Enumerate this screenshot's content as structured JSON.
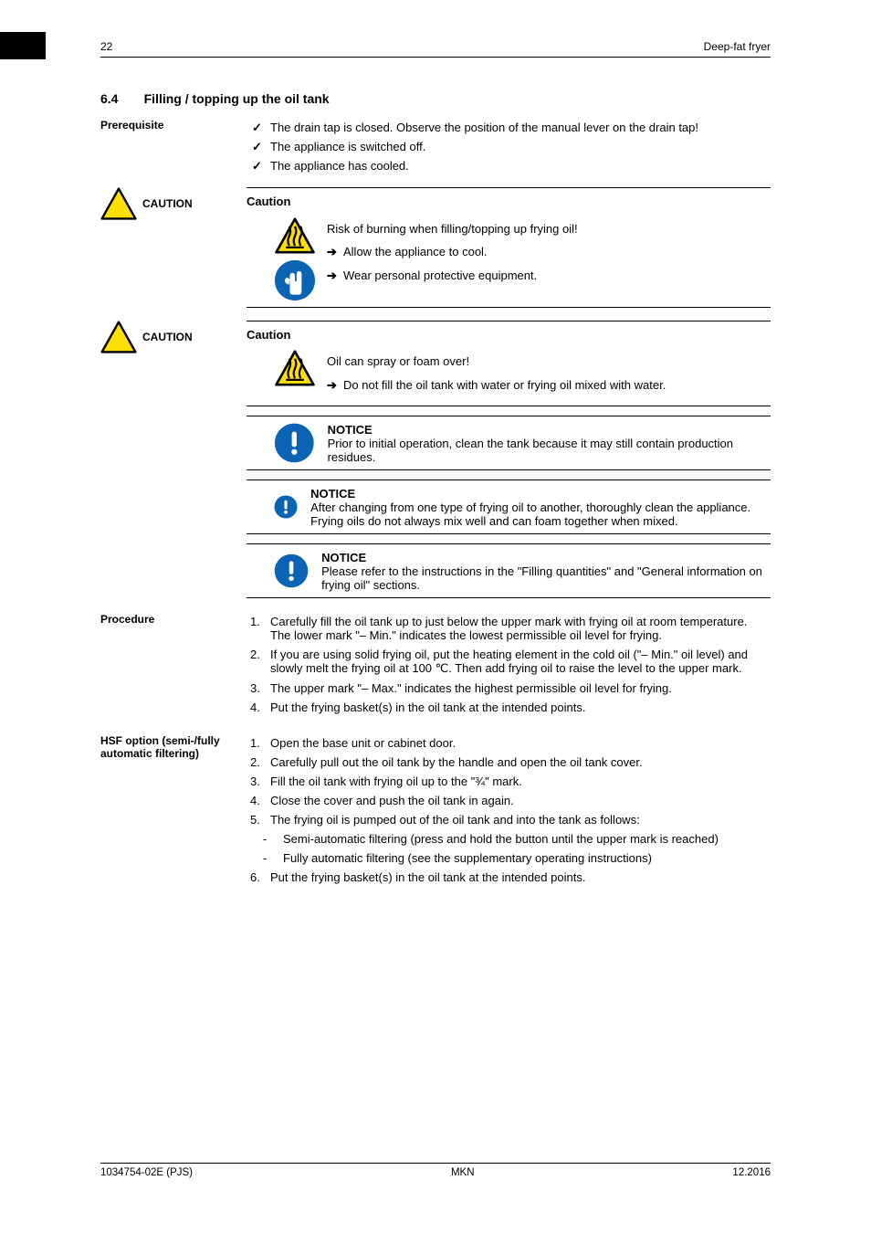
{
  "header": {
    "page_num": "22",
    "title": "Deep-fat fryer"
  },
  "section": {
    "number": "6.4",
    "title": "Filling / topping up the oil tank"
  },
  "sidebar": {
    "prereq": "Prerequisite",
    "caution1": "CAUTION",
    "caution2": "CAUTION",
    "procedure": "Procedure",
    "hsf": "HSF option (semi-/fully automatic filtering)"
  },
  "prereq": {
    "items": [
      "The drain tap is closed. Observe the position of the manual lever on the drain tap!",
      "The appliance is switched off.",
      "The appliance has cooled."
    ]
  },
  "caution1": {
    "label": "Caution",
    "line1": "Risk of burning when filling/topping up frying oil!",
    "bullet1": "Allow the appliance to cool.",
    "bullet2": "Wear personal protective equipment."
  },
  "caution2": {
    "label": "Caution",
    "line1": "Oil can spray or foam over!",
    "bullet1": "Do not fill the oil tank with water or frying oil mixed with water."
  },
  "notice1": {
    "label": "NOTICE",
    "text": "Prior to initial operation, clean the tank because it may still contain production residues."
  },
  "notice2": {
    "label": "NOTICE",
    "text": "After changing from one type of frying oil to another, thoroughly clean the appliance. Frying oils do not always mix well and can foam together when mixed."
  },
  "notice3": {
    "label": "NOTICE",
    "text": "Please refer to the instructions in the \"Filling quantities\" and \"General information on frying oil\" sections."
  },
  "procedure": {
    "items": [
      {
        "n": "1.",
        "text": "Carefully fill the oil tank up to just below the upper mark with frying oil at room temperature. The lower mark \"– Min.\" indicates the lowest permissible oil level for frying."
      },
      {
        "n": "2.",
        "text": "If you are using solid frying oil, put the heating element in the cold oil (\"– Min.\" oil level) and slowly melt the frying oil at 100 ℃. Then add frying oil to raise the level to the upper mark."
      },
      {
        "n": "3.",
        "text": "The upper mark \"– Max.\" indicates the highest permissible oil level for frying."
      },
      {
        "n": "4.",
        "text": "Put the frying basket(s) in the oil tank at the intended points."
      }
    ]
  },
  "hsf": {
    "items": [
      {
        "n": "1.",
        "text": "Open the base unit or cabinet door."
      },
      {
        "n": "2.",
        "text": "Carefully pull out the oil tank by the handle and open the oil tank cover."
      },
      {
        "n": "3.",
        "text": "Fill the oil tank with frying oil up to the \"¾\" mark."
      },
      {
        "n": "4.",
        "text": "Close the cover and push the oil tank in again."
      },
      {
        "n": "5.",
        "text": "The frying oil is pumped out of the oil tank and into the tank as follows:"
      },
      {
        "n": "- ",
        "text": "Semi-automatic filtering (press and hold the button until the upper mark is reached)"
      },
      {
        "n": "- ",
        "text": "Fully automatic filtering (see the supplementary operating instructions)"
      },
      {
        "n": "6.",
        "text": "Put the frying basket(s) in the oil tank at the intended points."
      }
    ]
  },
  "footer": {
    "left": "1034754-02E (PJS)",
    "center": "MKN",
    "right": "12.2016"
  },
  "chart_data": null
}
